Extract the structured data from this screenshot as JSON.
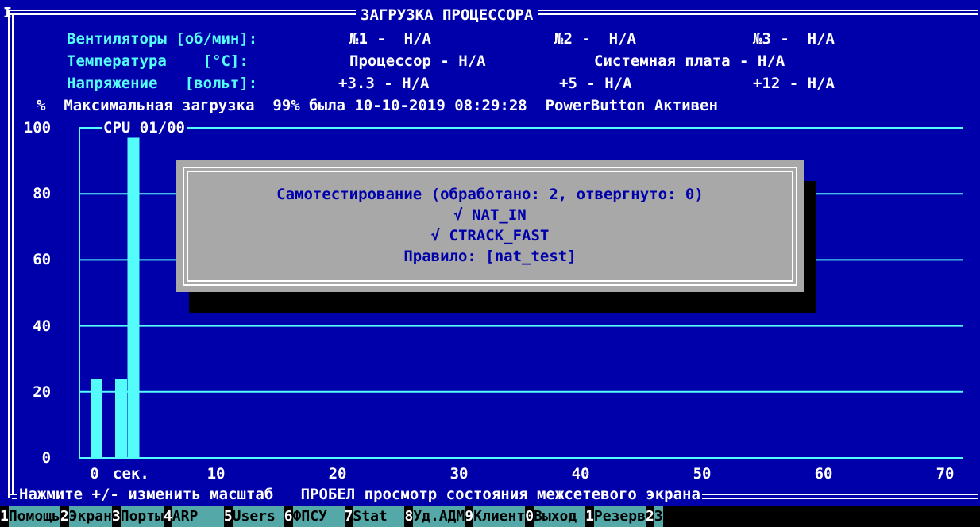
{
  "title": "ЗАГРУЗКА ПРОЦЕССОРА",
  "corner_marker": "I",
  "info": {
    "fans_label": "Вентиляторы [об/мин]:",
    "fan1": "№1 -  Н/А",
    "fan2": "№2 -  Н/А",
    "fan3": "№3 -  Н/А",
    "temp_label": "Температура    [°C]:",
    "temp_cpu": "Процессор - Н/А",
    "temp_board": "Системная плата - Н/А",
    "volt_label": "Напряжение   [вольт]:",
    "volt_33": "+3.3 - Н/А",
    "volt_5": "+5 - Н/А",
    "volt_12": "+12 - Н/А",
    "max_load_line": "%  Максимальная загрузка  99% была 10-10-2019 08:29:28  PowerButton Активен"
  },
  "chart_data": {
    "type": "bar",
    "title": "CPU 01/00",
    "xlabel": "сек.",
    "ylabel": "%",
    "xlim": [
      0,
      70
    ],
    "ylim": [
      0,
      100
    ],
    "y_ticks": [
      "0",
      "20",
      "40",
      "60",
      "80",
      "100"
    ],
    "x_ticks": [
      "0",
      "10",
      "20",
      "30",
      "40",
      "50",
      "60",
      "70"
    ],
    "bar_color": "#54fcfc",
    "x": [
      0,
      1,
      2,
      3
    ],
    "values": [
      24,
      0,
      24,
      97
    ]
  },
  "dialog": {
    "line1": "Самотестирование (обработано: 2, отвергнуто: 0)",
    "line2": "√ NAT_IN",
    "line3": "√ CTRACK_FAST",
    "line4": "Правило: [nat_test]"
  },
  "hint": "Нажмите +/- изменить масштаб   ПРОБЕЛ просмотр состояния межсетевого экрана",
  "function_keys": [
    {
      "num": "1",
      "label": "Помощь"
    },
    {
      "num": "2",
      "label": "Экран"
    },
    {
      "num": "3",
      "label": "Порты"
    },
    {
      "num": "4",
      "label": "ARP   "
    },
    {
      "num": "5",
      "label": "Users "
    },
    {
      "num": "6",
      "label": "ФПСУ  "
    },
    {
      "num": "7",
      "label": "Stat  "
    },
    {
      "num": "8",
      "label": "Уд.АДМ"
    },
    {
      "num": "9",
      "label": "Клиент"
    },
    {
      "num": "0",
      "label": "Выход "
    },
    {
      "num": "1",
      "label": "Резерв"
    },
    {
      "num": "2",
      "label": "З"
    }
  ],
  "colors": {
    "background": "#0000aa",
    "text": "#54fcfc",
    "dialog_bg": "#a8a8a8",
    "dialog_text": "#0000aa",
    "fkey_bg": "#54a8a8"
  }
}
